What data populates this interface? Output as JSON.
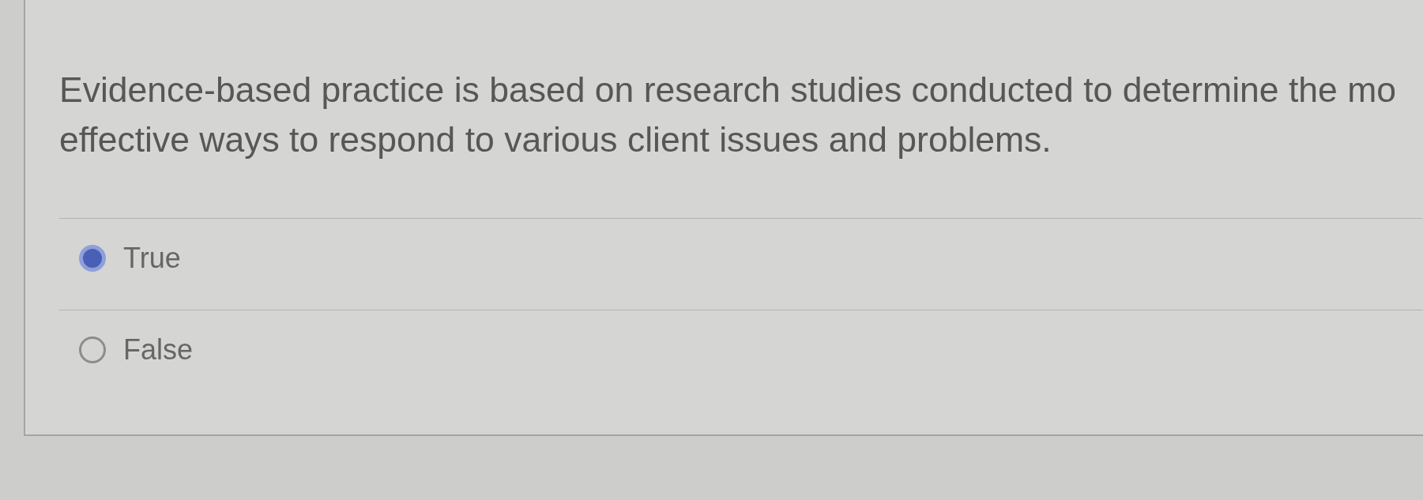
{
  "question": {
    "text_lines": [
      "Evidence-based practice is based on research studies conducted to determine the mo",
      "effective ways to respond to various client issues and problems."
    ]
  },
  "options": [
    {
      "label": "True",
      "selected": true
    },
    {
      "label": "False",
      "selected": false
    }
  ]
}
